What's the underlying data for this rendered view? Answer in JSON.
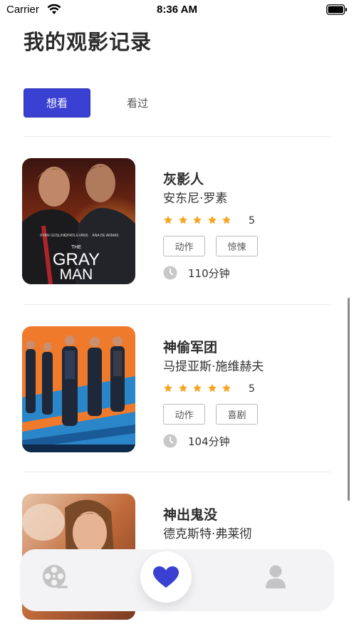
{
  "status_bar": {
    "carrier": "Carrier",
    "time": "8:36 AM"
  },
  "page": {
    "title": "我的观影记录"
  },
  "tabs": [
    {
      "label": "想看",
      "active": true
    },
    {
      "label": "看过",
      "active": false
    }
  ],
  "movies": [
    {
      "title": "灰影人",
      "director": "安东尼·罗素",
      "stars": 5,
      "rating": "5",
      "tags": [
        "动作",
        "惊悚"
      ],
      "duration": "110分钟",
      "poster_text": {
        "cast": [
          "RYAN GOSLING",
          "CHRIS EVANS",
          "ANA DE ARMAS"
        ],
        "title_line1": "THE",
        "title_line2": "GRAY",
        "title_line3": "MAN"
      }
    },
    {
      "title": "神偷军团",
      "director": "马提亚斯·施维赫夫",
      "stars": 5,
      "rating": "5",
      "tags": [
        "动作",
        "喜剧"
      ],
      "duration": "104分钟"
    },
    {
      "title": "神出鬼没",
      "director": "德克斯特·弗莱彻"
    }
  ],
  "tabbar": {
    "items": [
      {
        "icon": "film-reel-icon",
        "active": false
      },
      {
        "icon": "heart-icon",
        "active": true
      },
      {
        "icon": "user-icon",
        "active": false
      }
    ]
  },
  "colors": {
    "accent": "#3a40d2",
    "star": "#f5a623",
    "divider": "#e8e8e8"
  }
}
